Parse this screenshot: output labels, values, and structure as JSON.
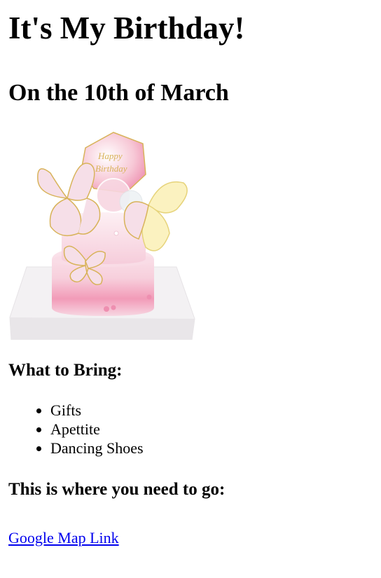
{
  "page": {
    "title": "It's My Birthday!",
    "subtitle": "On the 10th of March"
  },
  "image": {
    "subject": "cake-image",
    "colors": {
      "board": "#f3f1f3",
      "cake_light": "#f7d3df",
      "cake_pink": "#f29bb8",
      "gold": "#d8b35a",
      "butterfly_fill": "#f6dfe8",
      "butterfly_yellow": "#fbf2c0"
    }
  },
  "bring": {
    "heading": "What to Bring:",
    "items": [
      "Gifts",
      "Apettite",
      "Dancing Shoes"
    ]
  },
  "location": {
    "heading": "This is where you need to go:",
    "link_text": "Google Map Link"
  }
}
